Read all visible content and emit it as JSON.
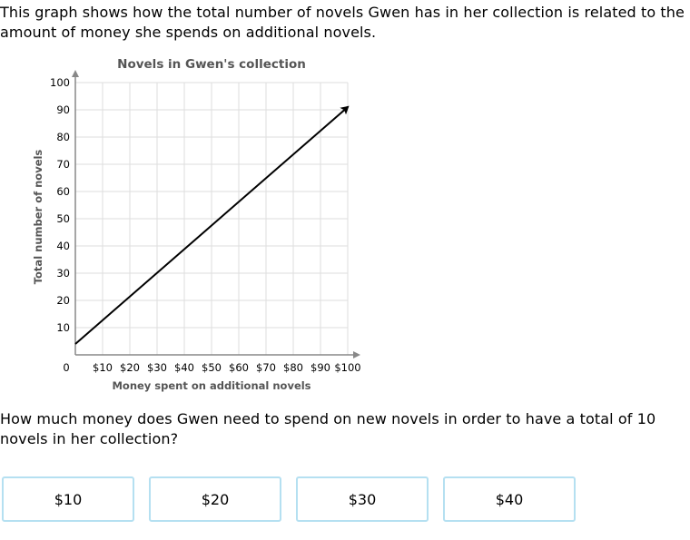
{
  "prompt": {
    "intro": "This graph shows how the total number of novels Gwen has in her collection is related to the amount of money she spends on additional novels.",
    "question": "How much money does Gwen need to spend on new novels in order to have a total of 10 novels in her collection?"
  },
  "chart_data": {
    "type": "line",
    "title": "Novels in Gwen's collection",
    "xlabel": "Money spent on additional novels",
    "ylabel": "Total number of novels",
    "xlim": [
      0,
      100
    ],
    "ylim": [
      0,
      100
    ],
    "x_ticks": [
      "0",
      "$10",
      "$20",
      "$30",
      "$40",
      "$50",
      "$60",
      "$70",
      "$80",
      "$90",
      "$100"
    ],
    "y_ticks": [
      "10",
      "20",
      "30",
      "40",
      "50",
      "60",
      "70",
      "80",
      "90",
      "100"
    ],
    "grid": true,
    "series": [
      {
        "x": [
          0,
          100
        ],
        "y": [
          4,
          91
        ],
        "end_arrow": true
      }
    ],
    "colors": {
      "line": "#000000",
      "grid": "#dddddd",
      "axis": "#888888",
      "title": "#555555"
    }
  },
  "choices": [
    "$10",
    "$20",
    "$30",
    "$40"
  ],
  "colors": {
    "choice_border": "#b5e0f1"
  }
}
